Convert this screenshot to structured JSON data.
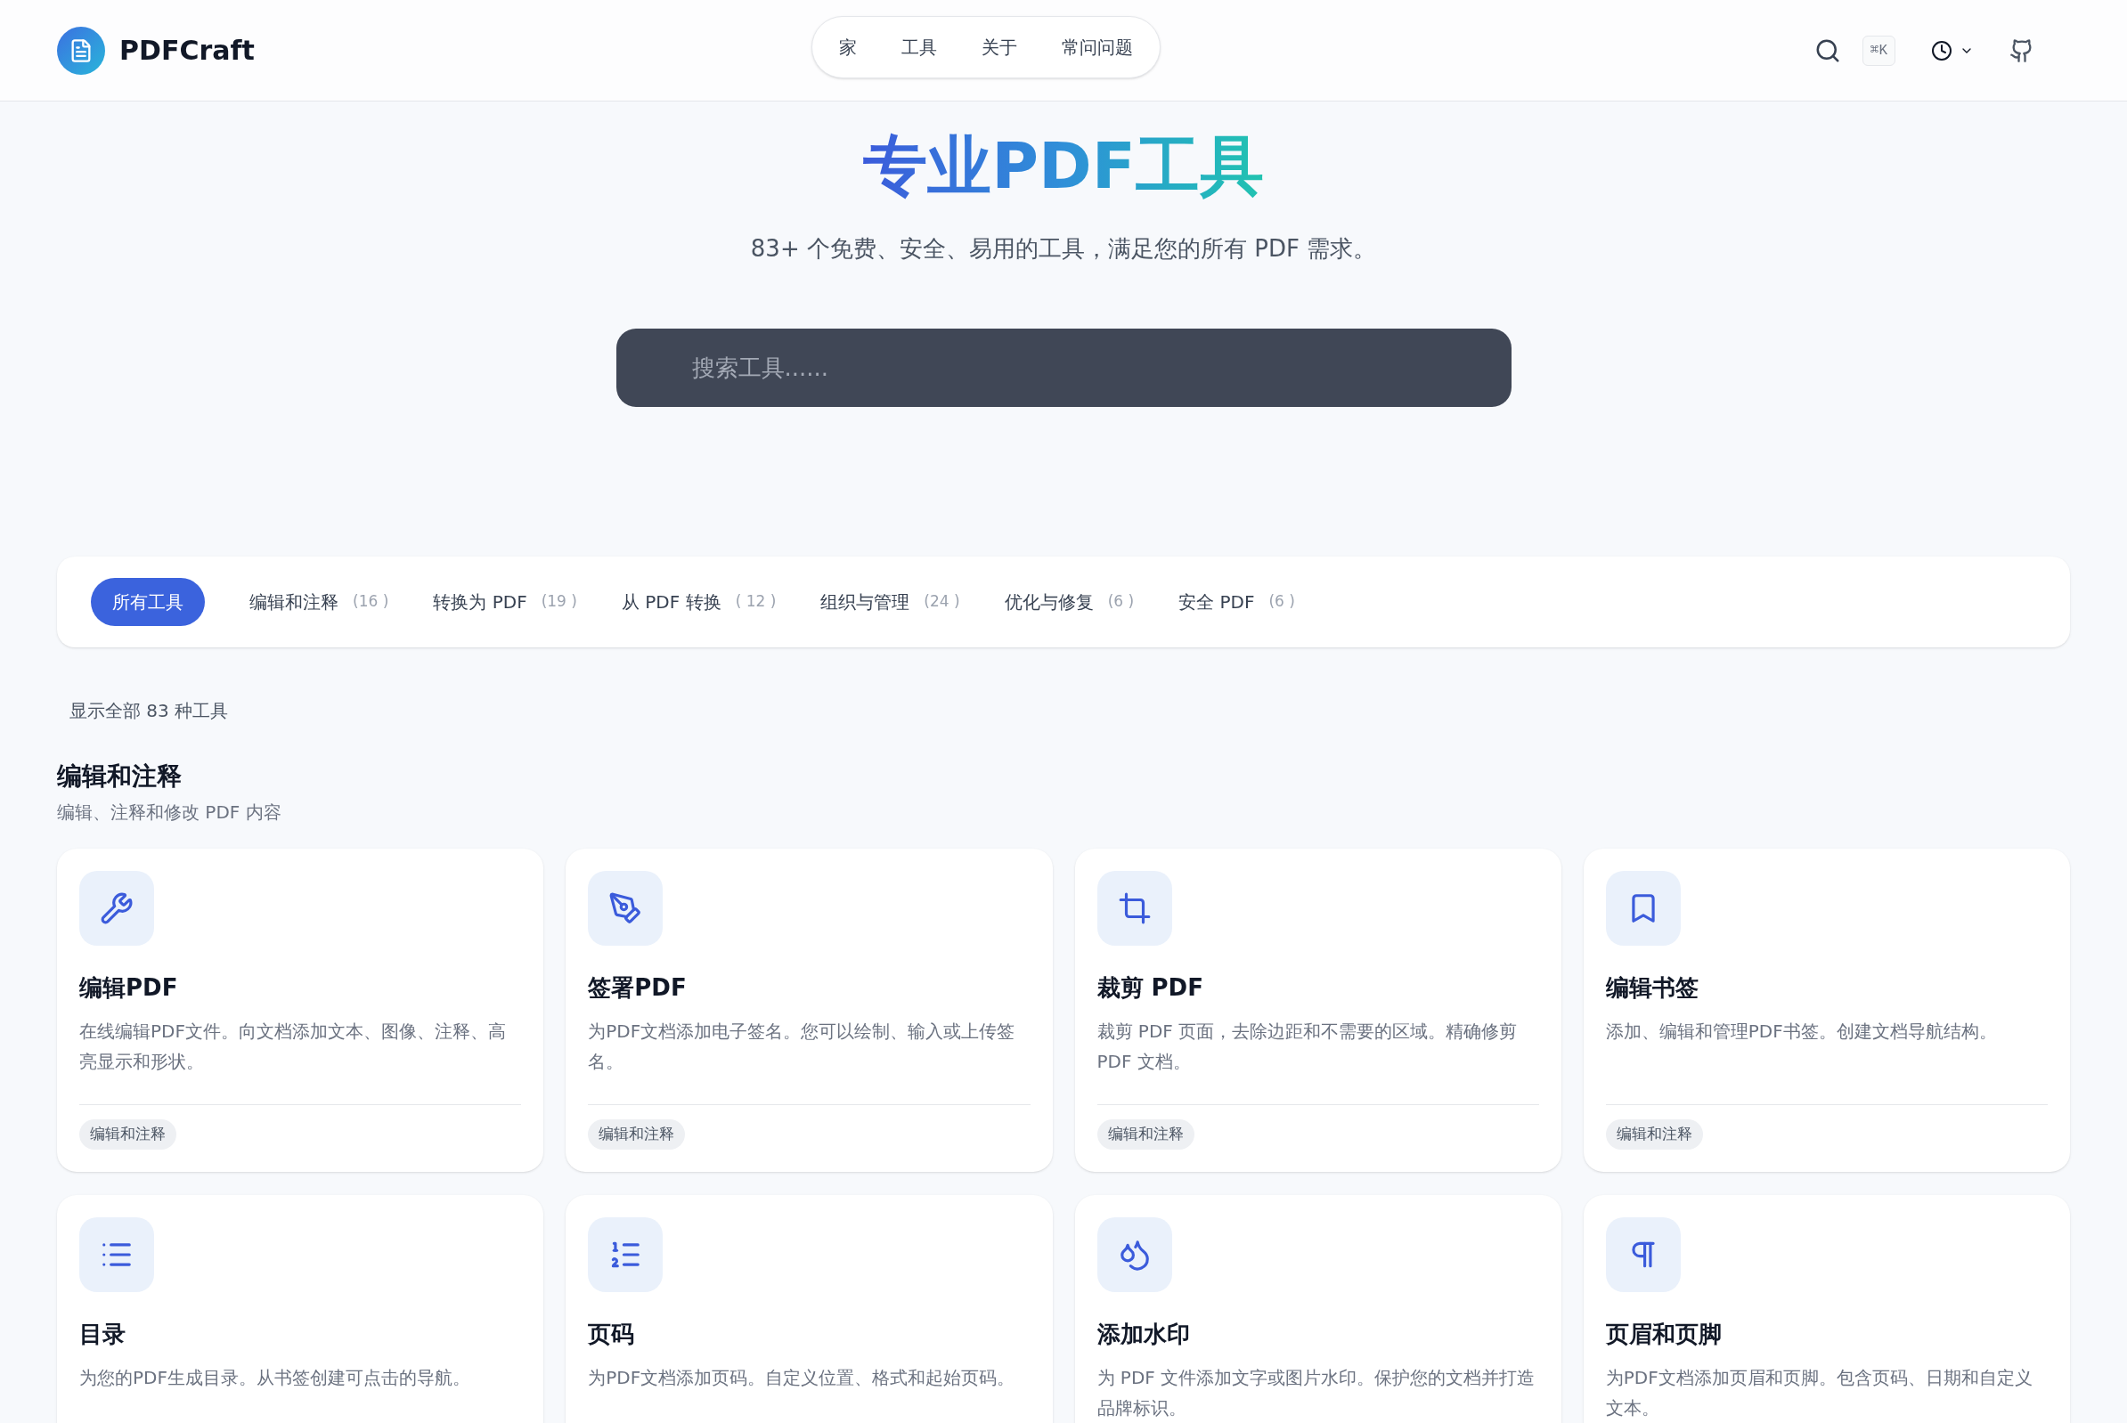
{
  "header": {
    "logo_text": "PDFCraft",
    "nav": [
      {
        "label": "家",
        "selected": false
      },
      {
        "label": "工具",
        "selected": false
      },
      {
        "label": "关于",
        "selected": false
      },
      {
        "label": "常问问题",
        "selected": false
      }
    ],
    "shortcut": "⌘K"
  },
  "hero": {
    "title": "专业PDF工具",
    "subtitle": "83+ 个免费、安全、易用的工具，满足您的所有 PDF 需求。",
    "search": {
      "placeholder": "搜索工具......"
    }
  },
  "tabs": [
    {
      "label": "所有工具",
      "selected": true
    },
    {
      "label": "编辑和注释",
      "count": "(16 )",
      "selected": false
    },
    {
      "label": "转换为 PDF",
      "count": "(19 )",
      "selected": false
    },
    {
      "label": "从 PDF 转换",
      "count": "( 12 )",
      "selected": false
    },
    {
      "label": "组织与管理",
      "count": "(24 )",
      "selected": false
    },
    {
      "label": "优化与修复",
      "count": "(6 )",
      "selected": false
    },
    {
      "label": "安全 PDF",
      "count": "(6 )",
      "selected": false
    }
  ],
  "result_count": "显示全部 83 种工具",
  "section": {
    "title": "编辑和注释",
    "description": "编辑、注释和修改 PDF 内容"
  },
  "cards": [
    {
      "title": "编辑PDF",
      "description": "在线编辑PDF文件。向文档添加文本、图像、注释、高亮显示和形状。",
      "tag": "编辑和注释"
    },
    {
      "title": "签署PDF",
      "description": "为PDF文档添加电子签名。您可以绘制、输入或上传签名。",
      "tag": "编辑和注释"
    },
    {
      "title": "裁剪 PDF",
      "description": "裁剪 PDF 页面，去除边距和不需要的区域。精确修剪 PDF 文档。",
      "tag": "编辑和注释"
    },
    {
      "title": "编辑书签",
      "description": "添加、编辑和管理PDF书签。创建文档导航结构。",
      "tag": "编辑和注释"
    },
    {
      "title": "目录",
      "description": "为您的PDF生成目录。从书签创建可点击的导航。"
    },
    {
      "title": "页码",
      "description": "为PDF文档添加页码。自定义位置、格式和起始页码。"
    },
    {
      "title": "添加水印",
      "description": "为 PDF 文件添加文字或图片水印。保护您的文档并打造品牌标识。"
    },
    {
      "title": "页眉和页脚",
      "description": "为PDF文档添加页眉和页脚。包含页码、日期和自定义文本。"
    }
  ]
}
